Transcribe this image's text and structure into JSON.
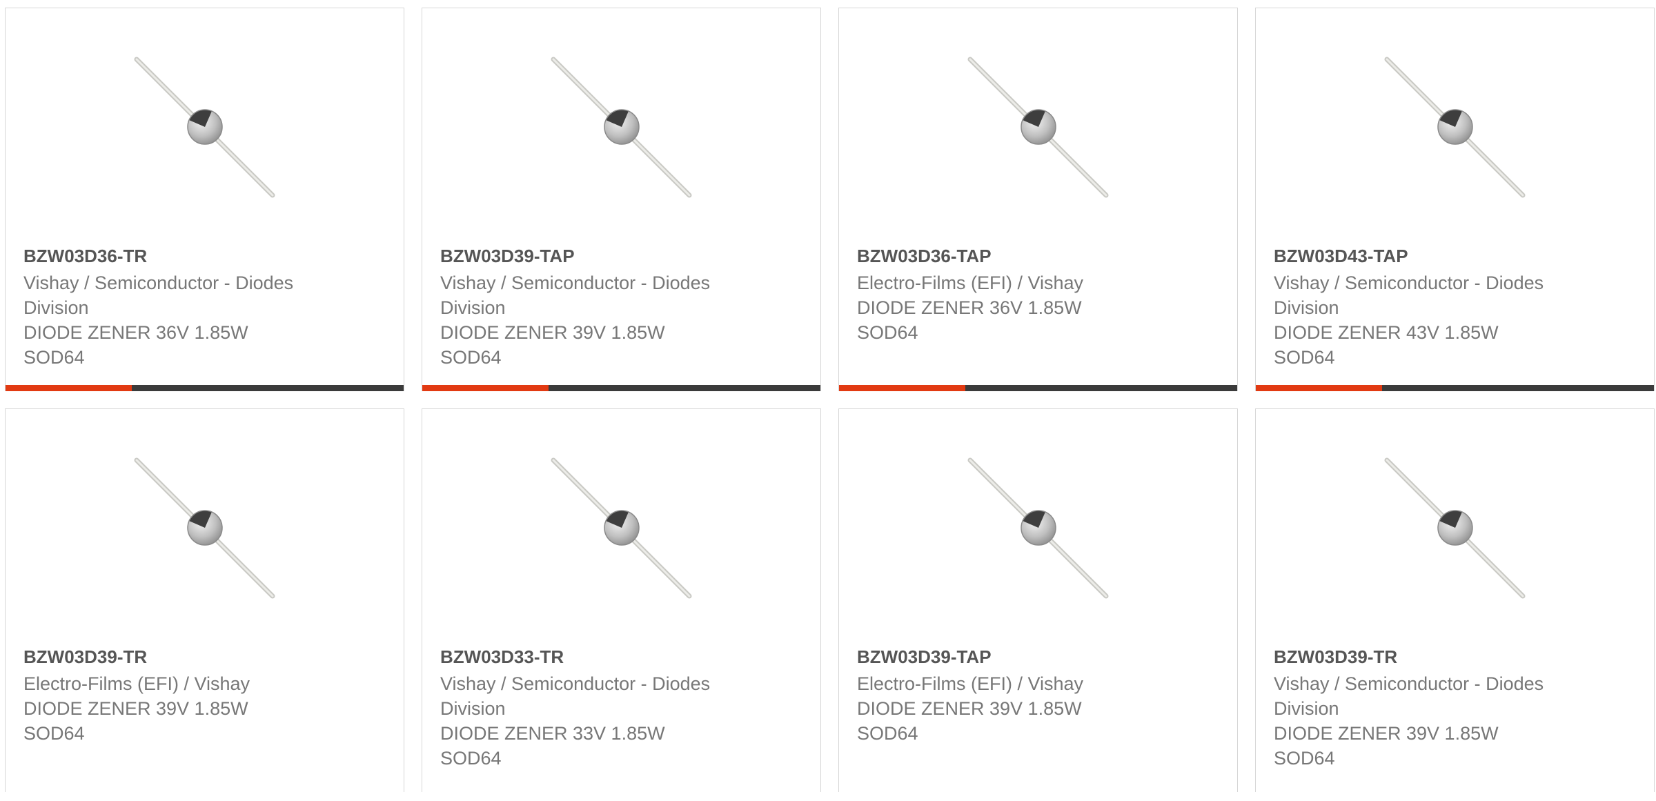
{
  "colors": {
    "accent": "#e23a12",
    "bar": "#3b3b3b",
    "border": "#d6d6d6",
    "text": "#777777",
    "title": "#555555"
  },
  "products": [
    {
      "part_number": "BZW03D36-TR",
      "manufacturer_lines": [
        "Vishay / Semiconductor - Diodes",
        "Division"
      ],
      "description": "DIODE ZENER 36V 1.85W",
      "package": "SOD64",
      "image_icon": "zener-diode-image"
    },
    {
      "part_number": "BZW03D39-TAP",
      "manufacturer_lines": [
        "Vishay / Semiconductor - Diodes",
        "Division"
      ],
      "description": "DIODE ZENER 39V 1.85W",
      "package": "SOD64",
      "image_icon": "zener-diode-image"
    },
    {
      "part_number": "BZW03D36-TAP",
      "manufacturer_lines": [
        "Electro-Films (EFI) / Vishay"
      ],
      "description": "DIODE ZENER 36V 1.85W",
      "package": "SOD64",
      "image_icon": "zener-diode-image"
    },
    {
      "part_number": "BZW03D43-TAP",
      "manufacturer_lines": [
        "Vishay / Semiconductor - Diodes",
        "Division"
      ],
      "description": "DIODE ZENER 43V 1.85W",
      "package": "SOD64",
      "image_icon": "zener-diode-image"
    },
    {
      "part_number": "BZW03D39-TR",
      "manufacturer_lines": [
        "Electro-Films (EFI) / Vishay"
      ],
      "description": "DIODE ZENER 39V 1.85W",
      "package": "SOD64",
      "image_icon": "zener-diode-image"
    },
    {
      "part_number": "BZW03D33-TR",
      "manufacturer_lines": [
        "Vishay / Semiconductor - Diodes",
        "Division"
      ],
      "description": "DIODE ZENER 33V 1.85W",
      "package": "SOD64",
      "image_icon": "zener-diode-image"
    },
    {
      "part_number": "BZW03D39-TAP",
      "manufacturer_lines": [
        "Electro-Films (EFI) / Vishay"
      ],
      "description": "DIODE ZENER 39V 1.85W",
      "package": "SOD64",
      "image_icon": "zener-diode-image"
    },
    {
      "part_number": "BZW03D39-TR",
      "manufacturer_lines": [
        "Vishay / Semiconductor - Diodes",
        "Division"
      ],
      "description": "DIODE ZENER 39V 1.85W",
      "package": "SOD64",
      "image_icon": "zener-diode-image"
    }
  ]
}
